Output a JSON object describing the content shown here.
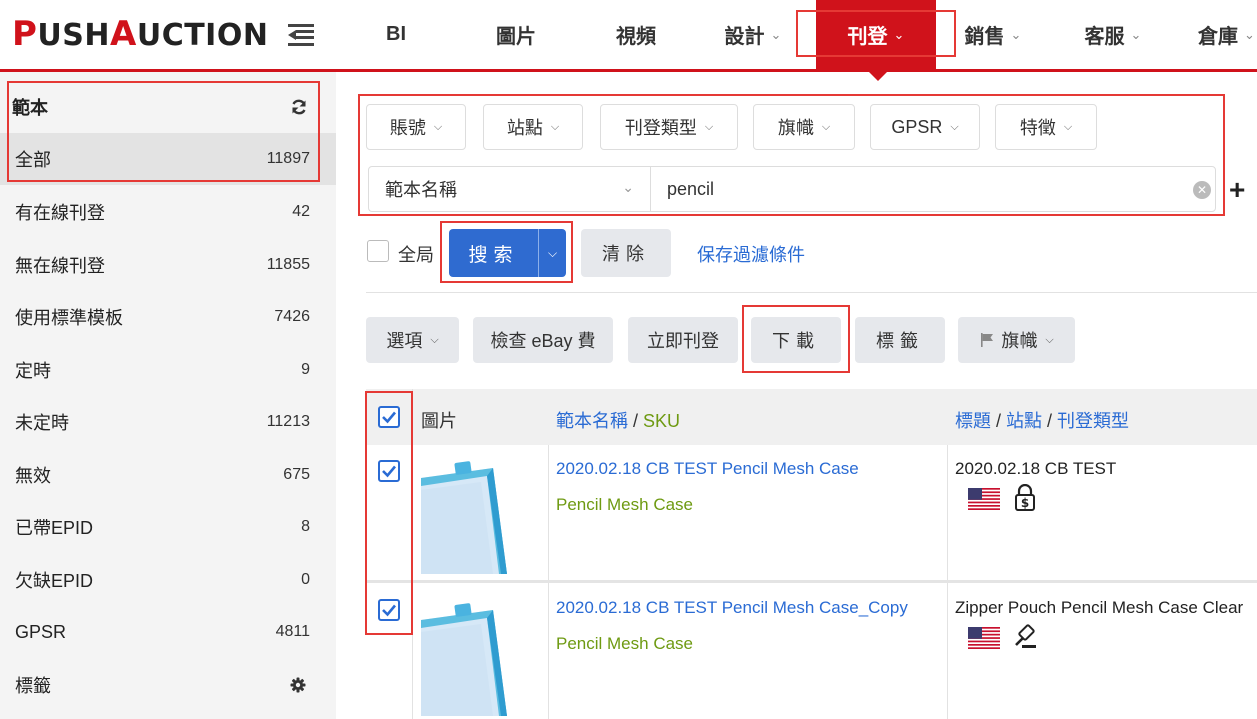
{
  "brand": {
    "logo_part1": "P",
    "logo_part2": "USH",
    "logo_part3": "A",
    "logo_part4": "UCTION",
    "accent_color": "#d0121b"
  },
  "nav": {
    "items": [
      {
        "label": "BI"
      },
      {
        "label": "圖片"
      },
      {
        "label": "視頻"
      },
      {
        "label": "設計"
      },
      {
        "label": "刊登",
        "active": true
      },
      {
        "label": "銷售"
      },
      {
        "label": "客服"
      },
      {
        "label": "倉庫"
      }
    ]
  },
  "sidebar": {
    "title": "範本",
    "items": [
      {
        "label": "全部",
        "count": "11897"
      },
      {
        "label": "有在線刊登",
        "count": "42"
      },
      {
        "label": "無在線刊登",
        "count": "11855"
      },
      {
        "label": "使用標準模板",
        "count": "7426"
      },
      {
        "label": "定時",
        "count": "9"
      },
      {
        "label": "未定時",
        "count": "11213"
      },
      {
        "label": "無效",
        "count": "675"
      },
      {
        "label": "已帶EPID",
        "count": "8"
      },
      {
        "label": "欠缺EPID",
        "count": "0"
      },
      {
        "label": "GPSR",
        "count": "4811"
      },
      {
        "label": "標籤",
        "count": ""
      }
    ]
  },
  "filters": {
    "buttons": [
      {
        "label": "賬號"
      },
      {
        "label": "站點"
      },
      {
        "label": "刊登類型"
      },
      {
        "label": "旗幟"
      },
      {
        "label": "GPSR"
      },
      {
        "label": "特徵"
      }
    ],
    "search_field": "範本名稱",
    "search_value": "pencil"
  },
  "actions": {
    "global_label": "全局",
    "search_label": "搜索",
    "clear_label": "清除",
    "save_filter_label": "保存過濾條件",
    "options_label": "選項",
    "check_fee_label": "檢查 eBay 費",
    "publish_now_label": "立即刊登",
    "download_label": "下載",
    "tag_label": "標籤",
    "flag_label": "旗幟"
  },
  "table": {
    "headers": {
      "image": "圖片",
      "name": "範本名稱",
      "sep1": " / ",
      "sku": "SKU",
      "title": "標題",
      "sep2": " / ",
      "site": "站點",
      "sep3": " / ",
      "type": "刊登類型"
    },
    "rows": [
      {
        "name": "2020.02.18 CB TEST Pencil Mesh Case",
        "sku": "Pencil Mesh Case",
        "title": "2020.02.18 CB TEST",
        "site_icon": "us-flag-icon",
        "type_icon": "fixed-price-icon"
      },
      {
        "name": "2020.02.18 CB TEST Pencil Mesh Case_Copy",
        "sku": "Pencil Mesh Case",
        "title": "Zipper Pouch Pencil Mesh Case Clear",
        "site_icon": "us-flag-icon",
        "type_icon": "auction-icon"
      }
    ]
  }
}
